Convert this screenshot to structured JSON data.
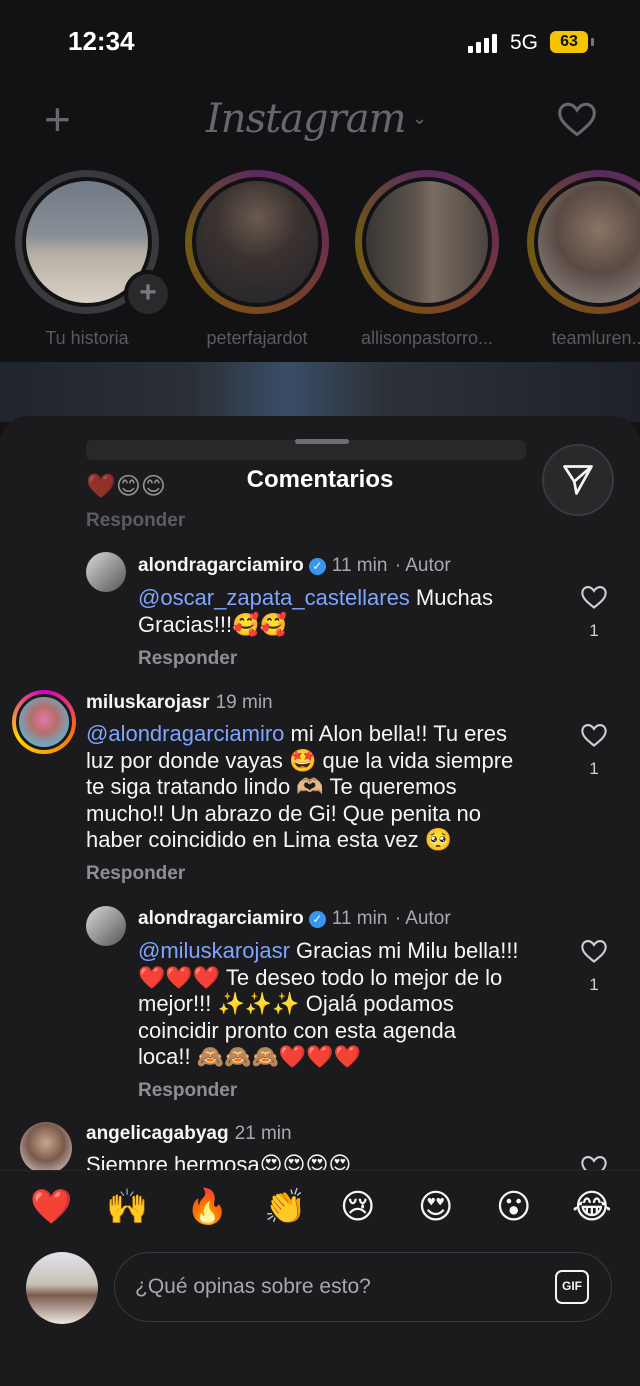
{
  "status": {
    "time": "12:34",
    "network": "5G",
    "battery": "63"
  },
  "header": {
    "logo": "Instagram"
  },
  "stories": [
    {
      "label": "Tu historia"
    },
    {
      "label": "peterfajardot"
    },
    {
      "label": "allisonpastorro..."
    },
    {
      "label": "teamluren..."
    }
  ],
  "sheet": {
    "title": "Comentarios",
    "faded_reply": "Responder",
    "faded_emojis": "❤️😊😊"
  },
  "comments": [
    {
      "username": "alondragarciamiro",
      "time": "11 min",
      "author": "· Autor",
      "mention": "@oscar_zapata_castellares",
      "text_l1": " Muchas",
      "text_l2": "Gracias!!!🥰🥰",
      "likes": "1",
      "reply": "Responder"
    },
    {
      "username": "miluskarojasr",
      "time": "19 min",
      "mention": "@alondragarciamiro",
      "text_l1": " mi Alon bella!! Tu eres",
      "text_l2": "luz por donde vayas 🤩 que la vida siempre",
      "text_l3": "te siga tratando lindo 🫶🏼 Te queremos",
      "text_l4": "mucho!! Un abrazo de Gi! Que penita no",
      "text_l5": "haber coincidido en Lima esta vez 🥺",
      "likes": "1",
      "reply": "Responder"
    },
    {
      "username": "alondragarciamiro",
      "time": "11 min",
      "author": "· Autor",
      "mention": "@miluskarojasr",
      "text_l1": " Gracias mi Milu bella!!!",
      "text_l2": "❤️❤️❤️ Te deseo todo lo mejor de lo",
      "text_l3": "mejor!!! ✨✨✨ Ojalá podamos",
      "text_l4": "coincidir pronto con esta agenda",
      "text_l5": "loca!! 🙈🙈🙈❤️❤️❤️",
      "likes": "1",
      "reply": "Responder"
    },
    {
      "username": "angelicagabyag",
      "time": "21 min",
      "text_l1": "Siempre hermosa😍😍😍😍"
    }
  ],
  "quick_emojis": [
    "❤️",
    "🙌",
    "🔥",
    "👏",
    "😢",
    "😍",
    "😮",
    "😂"
  ],
  "composer": {
    "placeholder": "¿Qué opinas sobre esto?",
    "gif": "GIF"
  },
  "colors": {
    "mention": "#7ea5ff",
    "verified": "#3797f0",
    "battery": "#f5c400"
  }
}
